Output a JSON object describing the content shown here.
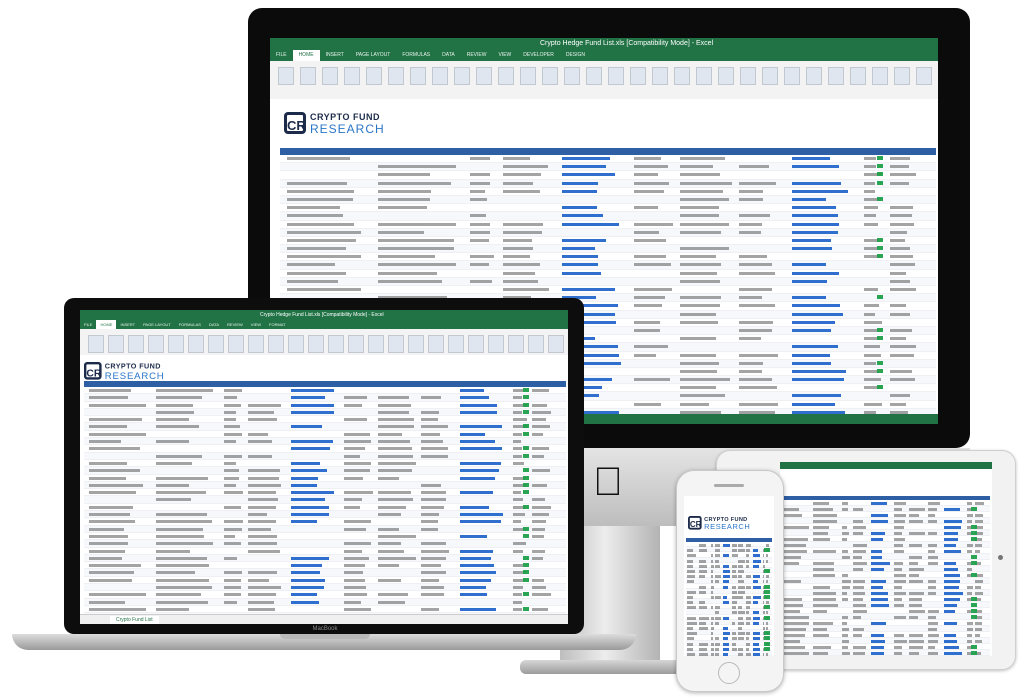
{
  "imac": {
    "window_title": "Crypto Hedge Fund List.xls [Compatibility Mode] - Excel",
    "ribbon_tabs": [
      "FILE",
      "HOME",
      "INSERT",
      "PAGE LAYOUT",
      "FORMULAS",
      "DATA",
      "REVIEW",
      "VIEW",
      "DEVELOPER",
      "DESIGN"
    ],
    "active_tab": "HOME"
  },
  "macbook": {
    "window_title": "Crypto Hedge Fund List.xls [Compatibility Mode] - Excel",
    "ribbon_tabs": [
      "FILE",
      "HOME",
      "INSERT",
      "PAGE LAYOUT",
      "FORMULAS",
      "DATA",
      "REVIEW",
      "VIEW",
      "FORMAT"
    ],
    "sheet_tab": "Crypto Fund List",
    "brand_label": "MacBook"
  },
  "logo": {
    "line1": "CRYPTO FUND",
    "line2": "RESEARCH",
    "mark": "CR"
  },
  "icons": {
    "apple": "apple-logo-icon"
  },
  "colors": {
    "excel_green": "#217346",
    "header_blue": "#2e5ea4",
    "link_blue": "#1a5fc8",
    "status_green": "#1fa04a"
  }
}
